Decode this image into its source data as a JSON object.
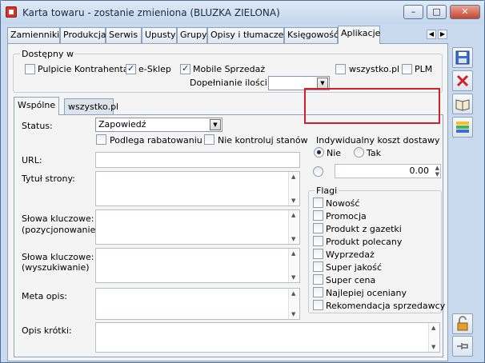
{
  "window": {
    "title": "Karta towaru - zostanie zmieniona (BLUZKA ZIELONA)"
  },
  "tabs": [
    {
      "label": "Zamienniki"
    },
    {
      "label": "Produkcja"
    },
    {
      "label": "Serwis"
    },
    {
      "label": "Upusty"
    },
    {
      "label": "Grupy"
    },
    {
      "label": "Opisy i tłumaczenia"
    },
    {
      "label": "Księgowość"
    },
    {
      "label": "Aplikacje"
    }
  ],
  "dostepny": {
    "label": "Dostępny w",
    "pulpit": {
      "label": "Pulpicie Kontrahenta",
      "checked": false
    },
    "esklep": {
      "label": "e-Sklep",
      "checked": true
    },
    "mobile": {
      "label": "Mobile Sprzedaż",
      "checked": true
    },
    "wszystko": {
      "label": "wszystko.pl",
      "checked": false
    },
    "plm": {
      "label": "PLM",
      "checked": false
    },
    "dopelnianie_label": "Dopełnianie ilości wg:",
    "dopelnianie_value": ""
  },
  "inner_tabs": [
    {
      "label": "Wspólne"
    },
    {
      "label": "wszystko.pl"
    }
  ],
  "form": {
    "status_label": "Status:",
    "status_value": "Zapowiedź",
    "podlega_label": "Podlega rabatowaniu",
    "nie_kontroluj_label": "Nie kontroluj stanów",
    "url_label": "URL:",
    "tytul_label": "Tytuł strony:",
    "slowa_poz_label1": "Słowa kluczowe:",
    "slowa_poz_label2": "(pozycjonowanie)",
    "slowa_wysz_label1": "Słowa kluczowe:",
    "slowa_wysz_label2": "(wyszukiwanie)",
    "meta_label": "Meta opis:",
    "opis_label": "Opis krótki:"
  },
  "koszt": {
    "label": "Indywidualny koszt dostawy",
    "nie": "Nie",
    "tak": "Tak",
    "amount": "0.00"
  },
  "flagi": {
    "label": "Flagi",
    "items": [
      "Nowość",
      "Promocja",
      "Produkt z gazetki",
      "Produkt polecany",
      "Wyprzedaż",
      "Super jakość",
      "Super cena",
      "Najlepiej oceniany",
      "Rekomendacja sprzedawcy"
    ]
  }
}
